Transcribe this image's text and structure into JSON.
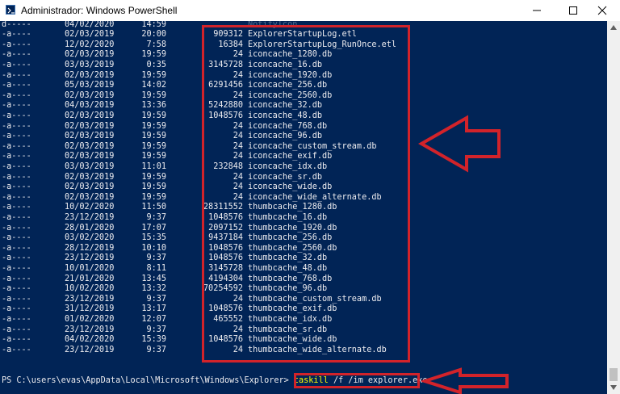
{
  "window": {
    "title": "Administrador: Windows PowerShell",
    "icon": "powershell-icon",
    "controls": [
      "minimize-icon",
      "maximize-icon",
      "close-icon"
    ]
  },
  "listing": {
    "rows": [
      {
        "mode": "d-----",
        "date": "04/02/2020",
        "time": "14:59",
        "length": "",
        "name": "NotifyIcon"
      },
      {
        "mode": "-a----",
        "date": "02/03/2019",
        "time": "20:00",
        "length": "909312",
        "name": "ExplorerStartupLog.etl"
      },
      {
        "mode": "-a----",
        "date": "12/02/2020",
        "time": "7:58",
        "length": "16384",
        "name": "ExplorerStartupLog_RunOnce.etl"
      },
      {
        "mode": "-a----",
        "date": "02/03/2019",
        "time": "19:59",
        "length": "24",
        "name": "iconcache_1280.db"
      },
      {
        "mode": "-a----",
        "date": "03/03/2019",
        "time": "0:35",
        "length": "3145728",
        "name": "iconcache_16.db"
      },
      {
        "mode": "-a----",
        "date": "02/03/2019",
        "time": "19:59",
        "length": "24",
        "name": "iconcache_1920.db"
      },
      {
        "mode": "-a----",
        "date": "05/03/2019",
        "time": "14:02",
        "length": "6291456",
        "name": "iconcache_256.db"
      },
      {
        "mode": "-a----",
        "date": "02/03/2019",
        "time": "19:59",
        "length": "24",
        "name": "iconcache_2560.db"
      },
      {
        "mode": "-a----",
        "date": "04/03/2019",
        "time": "13:36",
        "length": "5242880",
        "name": "iconcache_32.db"
      },
      {
        "mode": "-a----",
        "date": "02/03/2019",
        "time": "19:59",
        "length": "1048576",
        "name": "iconcache_48.db"
      },
      {
        "mode": "-a----",
        "date": "02/03/2019",
        "time": "19:59",
        "length": "24",
        "name": "iconcache_768.db"
      },
      {
        "mode": "-a----",
        "date": "02/03/2019",
        "time": "19:59",
        "length": "24",
        "name": "iconcache_96.db"
      },
      {
        "mode": "-a----",
        "date": "02/03/2019",
        "time": "19:59",
        "length": "24",
        "name": "iconcache_custom_stream.db"
      },
      {
        "mode": "-a----",
        "date": "02/03/2019",
        "time": "19:59",
        "length": "24",
        "name": "iconcache_exif.db"
      },
      {
        "mode": "-a----",
        "date": "03/03/2019",
        "time": "11:01",
        "length": "232848",
        "name": "iconcache_idx.db"
      },
      {
        "mode": "-a----",
        "date": "02/03/2019",
        "time": "19:59",
        "length": "24",
        "name": "iconcache_sr.db"
      },
      {
        "mode": "-a----",
        "date": "02/03/2019",
        "time": "19:59",
        "length": "24",
        "name": "iconcache_wide.db"
      },
      {
        "mode": "-a----",
        "date": "02/03/2019",
        "time": "19:59",
        "length": "24",
        "name": "iconcache_wide_alternate.db"
      },
      {
        "mode": "-a----",
        "date": "10/02/2020",
        "time": "11:50",
        "length": "28311552",
        "name": "thumbcache_1280.db"
      },
      {
        "mode": "-a----",
        "date": "23/12/2019",
        "time": "9:37",
        "length": "1048576",
        "name": "thumbcache_16.db"
      },
      {
        "mode": "-a----",
        "date": "28/01/2020",
        "time": "17:07",
        "length": "2097152",
        "name": "thumbcache_1920.db"
      },
      {
        "mode": "-a----",
        "date": "03/02/2020",
        "time": "15:35",
        "length": "9437184",
        "name": "thumbcache_256.db"
      },
      {
        "mode": "-a----",
        "date": "28/12/2019",
        "time": "10:10",
        "length": "1048576",
        "name": "thumbcache_2560.db"
      },
      {
        "mode": "-a----",
        "date": "23/12/2019",
        "time": "9:37",
        "length": "1048576",
        "name": "thumbcache_32.db"
      },
      {
        "mode": "-a----",
        "date": "10/01/2020",
        "time": "8:11",
        "length": "3145728",
        "name": "thumbcache_48.db"
      },
      {
        "mode": "-a----",
        "date": "21/01/2020",
        "time": "13:45",
        "length": "4194304",
        "name": "thumbcache_768.db"
      },
      {
        "mode": "-a----",
        "date": "10/02/2020",
        "time": "13:32",
        "length": "70254592",
        "name": "thumbcache_96.db"
      },
      {
        "mode": "-a----",
        "date": "23/12/2019",
        "time": "9:37",
        "length": "24",
        "name": "thumbcache_custom_stream.db"
      },
      {
        "mode": "-a----",
        "date": "31/12/2019",
        "time": "13:17",
        "length": "1048576",
        "name": "thumbcache_exif.db"
      },
      {
        "mode": "-a----",
        "date": "01/02/2020",
        "time": "12:07",
        "length": "465552",
        "name": "thumbcache_idx.db"
      },
      {
        "mode": "-a----",
        "date": "23/12/2019",
        "time": "9:37",
        "length": "24",
        "name": "thumbcache_sr.db"
      },
      {
        "mode": "-a----",
        "date": "04/02/2020",
        "time": "15:39",
        "length": "1048576",
        "name": "thumbcache_wide.db"
      },
      {
        "mode": "-a----",
        "date": "23/12/2019",
        "time": "9:37",
        "length": "24",
        "name": "thumbcache_wide_alternate.db"
      }
    ]
  },
  "prompt": {
    "path": "PS C:\\users\\evas\\AppData\\Local\\Microsoft\\Windows\\Explorer> ",
    "command": "taskill",
    "args": " /f /im explorer.exe"
  },
  "annotations": {
    "color": "#d2232a",
    "list_arrow_icon": "left-arrow-icon",
    "command_arrow_icon": "left-arrow-icon"
  },
  "colors": {
    "console_background": "#012456",
    "console_text": "#eeedf0",
    "command_text": "#ffff00"
  }
}
